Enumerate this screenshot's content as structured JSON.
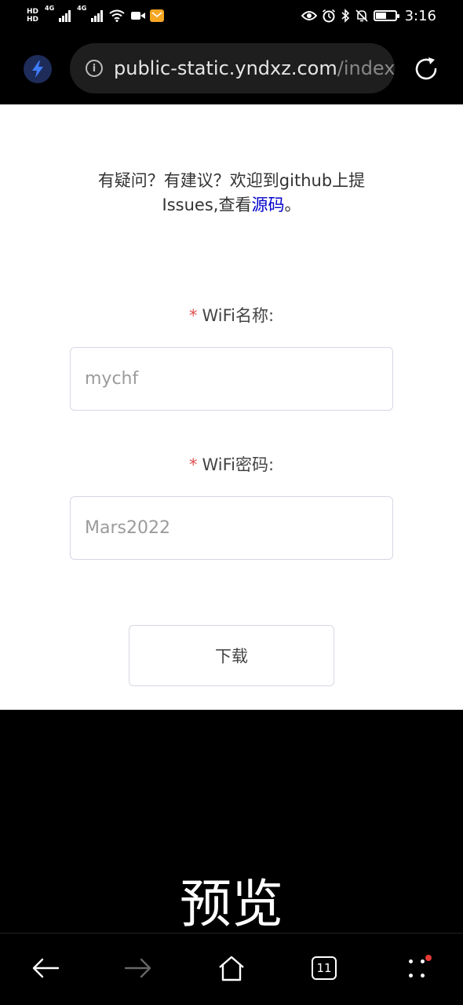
{
  "status_bar": {
    "hd_top": "HD",
    "hd_bottom": "HD",
    "net1": "4G",
    "net2": "4G",
    "time": "3:16",
    "battery_level": 0.55
  },
  "browser": {
    "url_main": "public-static.yndxz.com",
    "url_rest": "/index",
    "tab_count": "11"
  },
  "page": {
    "notice_text": "有疑问？有建议？欢迎到github上提Issues,查看",
    "notice_link": "源码",
    "notice_end": "。",
    "wifi_name_label": "WiFi名称:",
    "wifi_name_placeholder": "mychf",
    "wifi_pass_label": "WiFi密码:",
    "wifi_pass_placeholder": "Mars2022",
    "required_mark": "*",
    "download_button": "下载"
  },
  "caption": "预览",
  "icons": {
    "bolt": "bolt-icon",
    "info": "info-icon",
    "reload": "reload-icon",
    "back": "back-arrow-icon",
    "forward": "forward-arrow-icon",
    "home": "home-icon",
    "tabs": "tabs-icon",
    "menu": "menu-dots-icon"
  },
  "colors": {
    "link": "#0000cc",
    "required": "#e05050",
    "bolt_bg": "#1e2c5a",
    "bolt": "#3d7bff",
    "notification_dot": "#e53935"
  }
}
